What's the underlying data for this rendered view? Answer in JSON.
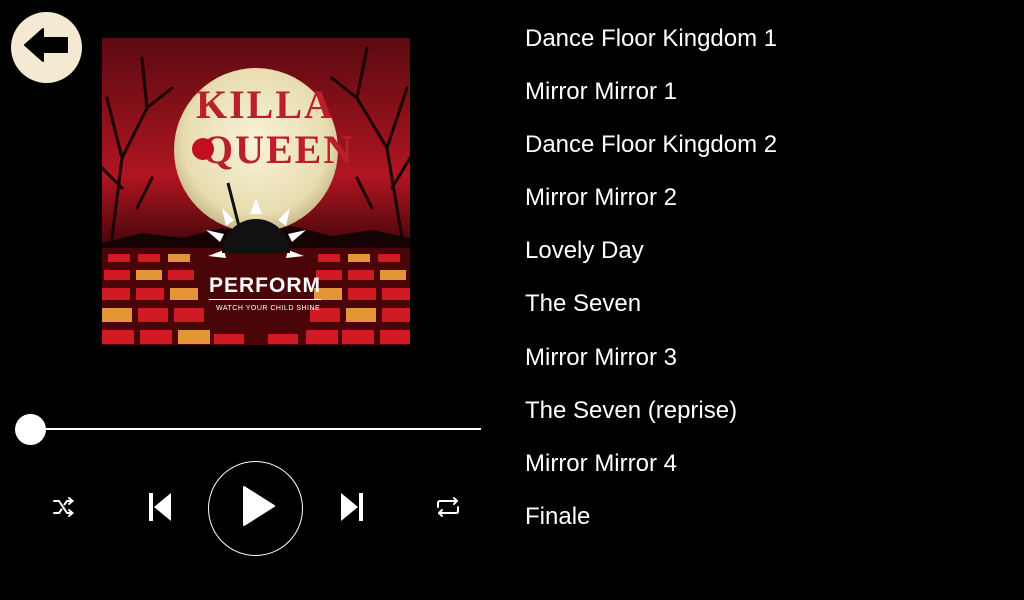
{
  "icons": {
    "back": "arrow-left-icon",
    "shuffle": "shuffle-icon",
    "previous": "skip-previous-icon",
    "play": "play-icon",
    "next": "skip-next-icon",
    "repeat": "repeat-icon"
  },
  "album": {
    "title_line1": "KILLA",
    "title_line2": "QUEEN",
    "brand": "PERFORM",
    "tagline": "WATCH YOUR CHILD SHINE"
  },
  "player": {
    "progress": 0.0
  },
  "tracks": [
    {
      "title": "Dance Floor Kingdom 1"
    },
    {
      "title": "Mirror Mirror 1"
    },
    {
      "title": "Dance Floor Kingdom 2"
    },
    {
      "title": "Mirror Mirror 2"
    },
    {
      "title": "Lovely Day"
    },
    {
      "title": "The Seven"
    },
    {
      "title": "Mirror Mirror 3"
    },
    {
      "title": "The Seven (reprise)"
    },
    {
      "title": "Mirror Mirror 4"
    },
    {
      "title": "Finale"
    }
  ],
  "colors": {
    "background": "#000000",
    "back_button_bg": "#f4ead4",
    "title_red": "#b8202a",
    "cover_red": "#c0101a"
  }
}
